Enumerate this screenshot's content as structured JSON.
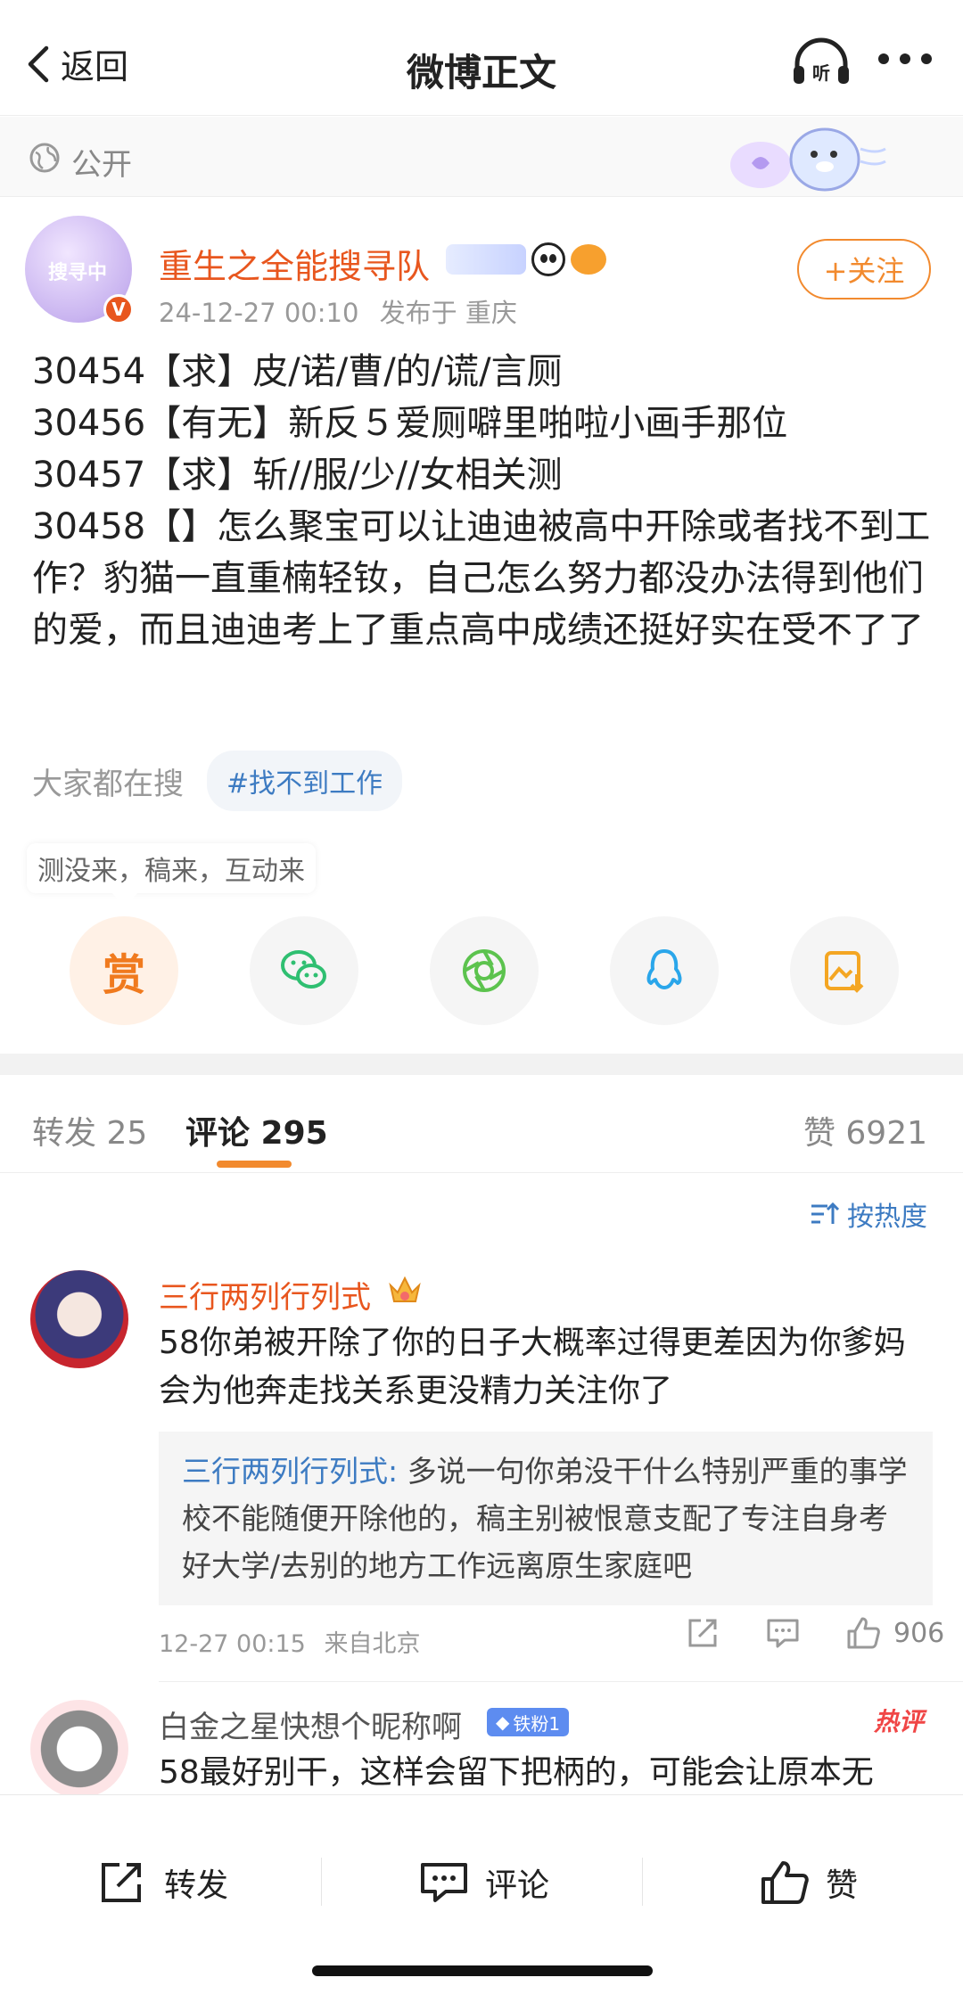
{
  "nav": {
    "back_label": "返回",
    "title": "微博正文",
    "listen_label": "听"
  },
  "visibility": {
    "label": "公开"
  },
  "post": {
    "author": "重生之全能搜寻队",
    "avatar_text": "搜寻中",
    "date": "24-12-27 00:10",
    "location": "发布于 重庆",
    "follow_label": "+关注",
    "lines": [
      "30454【求】皮/诺/曹/的/谎/言厕",
      "30456【有无】新反５爱厕噼里啪啦小画手那位",
      "30457【求】斩//服/少//女相关测",
      "30458【】怎么聚宝可以让迪迪被高中开除或者找不到工作？豹猫一直重楠轻钕，自己怎么努力都没办法得到他们的爱，而且迪迪考上了重点高中成绩还挺好实在受不了了"
    ],
    "search_label": "大家都在搜",
    "search_tag": "#找不到工作",
    "tip": "测没来，稿来，互动来",
    "reward_label": "赏"
  },
  "tabs": {
    "repost": "转发 25",
    "comments": "评论 295",
    "likes": "赞 6921"
  },
  "sort_label": "按热度",
  "comments": [
    {
      "name": "三行两列行列式",
      "text": "58你弟被开除了你的日子大概率过得更差因为你爹妈会为他奔走找关系更没精力关注你了",
      "reply_name": "三行两列行列式:",
      "reply_text": " 多说一句你弟没干什么特别严重的事学校不能随便开除他的，稿主别被恨意支配了专注自身考好大学/去别的地方工作远离原生家庭吧",
      "time": "12-27 00:15",
      "source": "来自北京",
      "likes": "906"
    },
    {
      "name": "白金之星快想个昵称啊",
      "badge": "铁粉1",
      "hot_tag": "热评",
      "text": "58最好别干，这样会留下把柄的，可能会让原本无"
    }
  ],
  "bottom_bar": {
    "repost": "转发",
    "comment": "评论",
    "like": "赞"
  },
  "colors": {
    "accent": "#f28a2e",
    "name_orange": "#e8561e",
    "link_blue": "#3d7bc2"
  }
}
